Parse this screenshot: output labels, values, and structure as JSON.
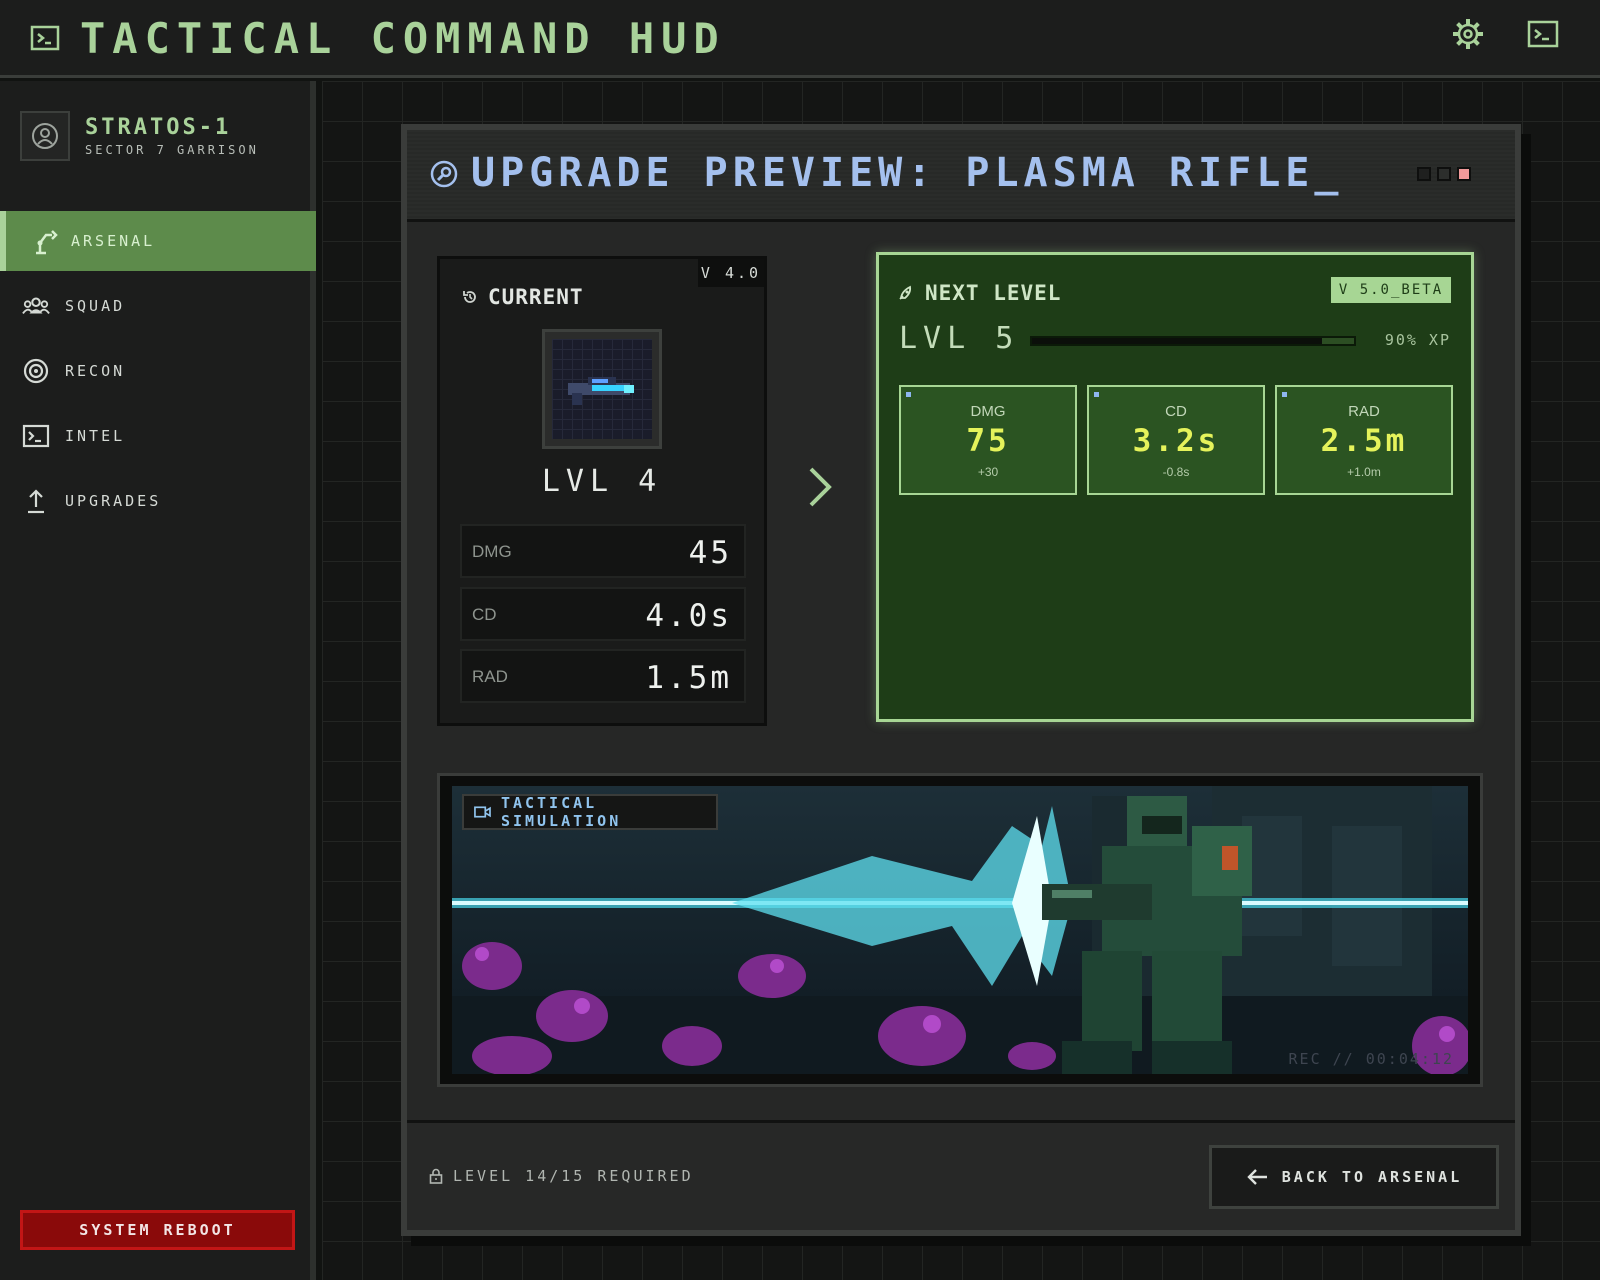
{
  "header": {
    "title": "TACTICAL COMMAND HUD",
    "logo_icon": "terminal-icon",
    "actions": [
      {
        "icon": "gear-icon"
      },
      {
        "icon": "terminal-icon"
      }
    ]
  },
  "sidebar": {
    "profile": {
      "name": "STRATOS-1",
      "subtitle": "SECTOR 7 GARRISON",
      "icon": "user-circle-icon"
    },
    "items": [
      {
        "label": "ARSENAL",
        "icon": "robot-arm-icon",
        "active": true
      },
      {
        "label": "SQUAD",
        "icon": "group-icon",
        "active": false
      },
      {
        "label": "RECON",
        "icon": "target-icon",
        "active": false
      },
      {
        "label": "INTEL",
        "icon": "terminal-icon",
        "active": false
      },
      {
        "label": "UPGRADES",
        "icon": "upload-arrow-icon",
        "active": false
      }
    ],
    "reboot_label": "SYSTEM REBOOT"
  },
  "modal": {
    "title": "UPGRADE PREVIEW: PLASMA RIFLE_",
    "title_icon": "wrench-circle-icon",
    "window_dots": [
      "#1f201f",
      "#2c2e2c",
      "#f29a9a"
    ],
    "current": {
      "label": "CURRENT",
      "icon": "history-icon",
      "version": "V 4.0",
      "weapon_icon": "plasma-rifle-icon",
      "level": "LVL 4",
      "stats": [
        {
          "key": "DMG",
          "value": "45"
        },
        {
          "key": "CD",
          "value": "4.0s"
        },
        {
          "key": "RAD",
          "value": "1.5m"
        }
      ]
    },
    "arrow_icon": "chevron-right-icon",
    "next": {
      "label": "NEXT LEVEL",
      "icon": "rocket-icon",
      "version": "V 5.0_BETA",
      "level": "LVL 5",
      "xp_fraction": 0.9,
      "xp_label": "90% XP",
      "stats": [
        {
          "key": "DMG",
          "value": "75",
          "delta": "+30"
        },
        {
          "key": "CD",
          "value": "3.2s",
          "delta": "-0.8s"
        },
        {
          "key": "RAD",
          "value": "2.5m",
          "delta": "+1.0m"
        }
      ]
    },
    "simulation": {
      "label": "TACTICAL SIMULATION",
      "icon": "video-camera-icon",
      "rec": "REC // 00:04:12"
    },
    "footer": {
      "requirement": "LEVEL 14/15 REQUIRED",
      "lock_icon": "lock-icon",
      "back_label": "BACK TO ARSENAL",
      "back_icon": "arrow-left-icon"
    }
  },
  "colors": {
    "accent_green": "#a9d29a",
    "active_nav": "#5d8b4b",
    "title_blue": "#a4c0ee",
    "next_card_bg": "#1e3d17",
    "stat_yellow": "#e5f35b",
    "reboot_red": "#8a0a0a"
  }
}
